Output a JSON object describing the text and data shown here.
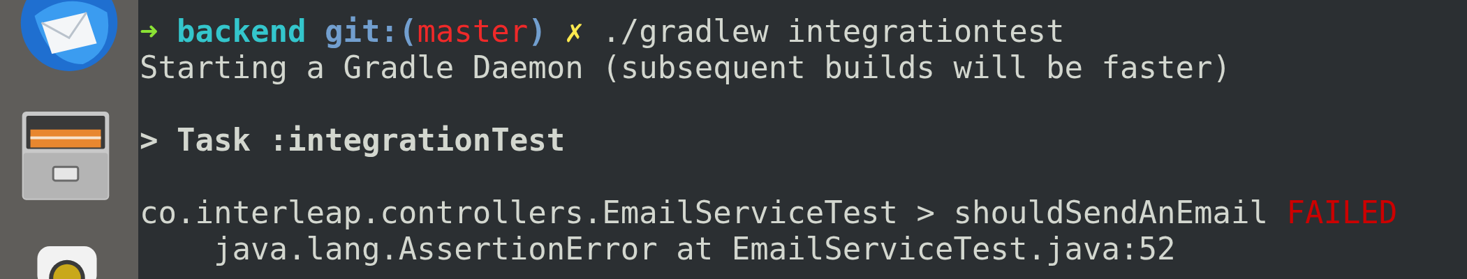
{
  "terminal": {
    "lines": [
      {
        "kind": "prompt",
        "arrow": "➜",
        "directory": "backend",
        "git_label": "git:(",
        "branch": "master",
        "git_close": ")",
        "dirty_mark": "✗",
        "command": "./gradlew integrationtest"
      },
      {
        "kind": "output",
        "text": "Starting a Gradle Daemon (subsequent builds will be faster)"
      },
      {
        "kind": "blank"
      },
      {
        "kind": "task",
        "text": "> Task :integrationTest"
      },
      {
        "kind": "blank"
      },
      {
        "kind": "test",
        "text": "co.interleap.controllers.EmailServiceTest > shouldSendAnEmail",
        "status": "FAILED"
      },
      {
        "kind": "output",
        "text": "    java.lang.AssertionError at EmailServiceTest.java:52"
      }
    ]
  }
}
